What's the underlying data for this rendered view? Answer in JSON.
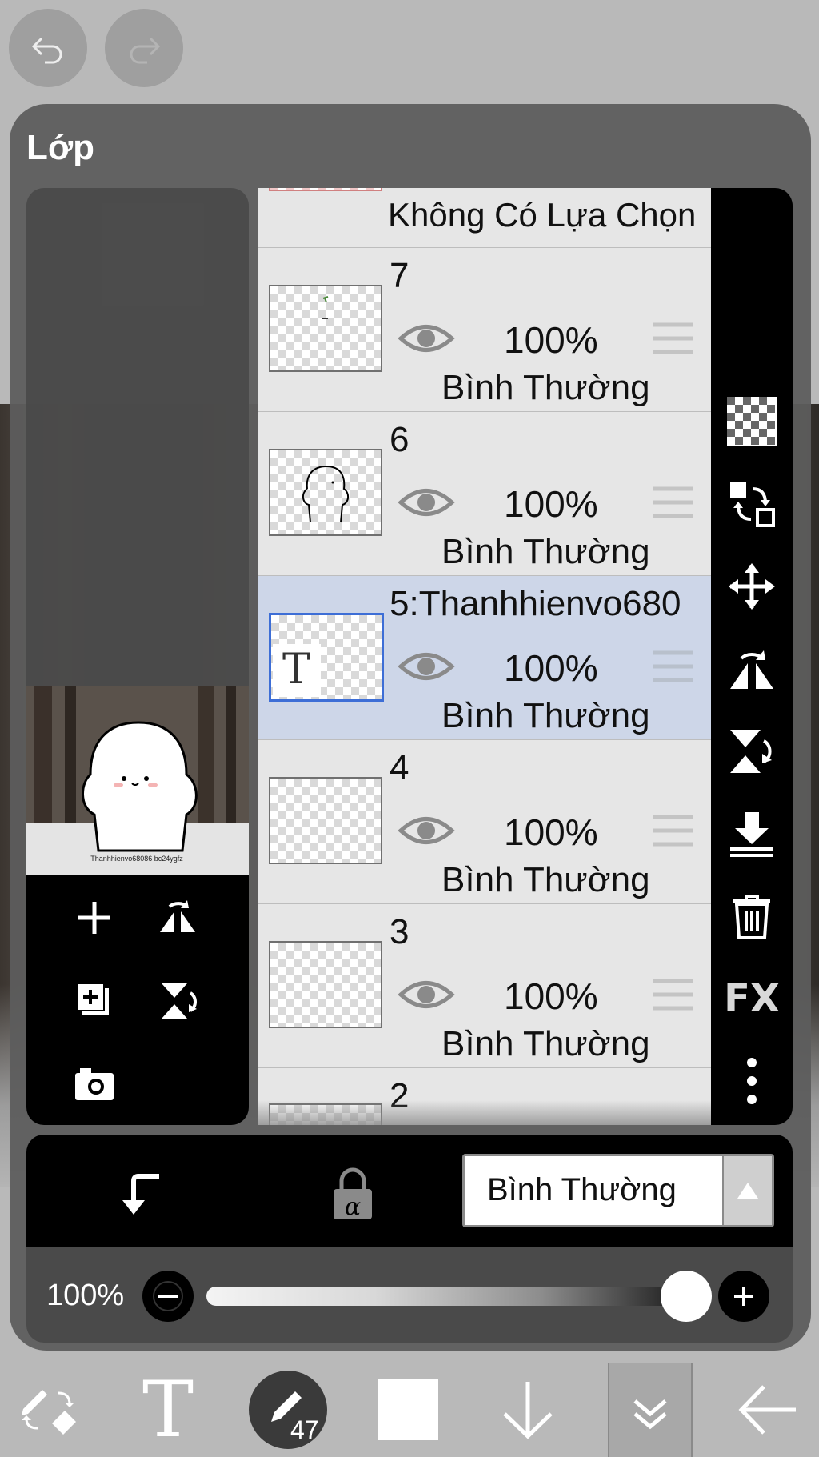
{
  "panel": {
    "title": "Lớp"
  },
  "preview": {
    "caption": "Thanhhienvo68086 bc24ygfz"
  },
  "layers": [
    {
      "name": "Không Có Lựa Chọn",
      "partial": true
    },
    {
      "name": "7",
      "opacity": "100%",
      "blend": "Bình Thường"
    },
    {
      "name": "6",
      "opacity": "100%",
      "blend": "Bình Thường"
    },
    {
      "name": "5:Thanhhienvo680",
      "opacity": "100%",
      "blend": "Bình Thường",
      "selected": true,
      "thumb_letter": "T"
    },
    {
      "name": "4",
      "opacity": "100%",
      "blend": "Bình Thường"
    },
    {
      "name": "3",
      "opacity": "100%",
      "blend": "Bình Thường"
    },
    {
      "name": "2"
    }
  ],
  "blend_mode": {
    "value": "Bình Thường"
  },
  "opacity": {
    "label": "100%",
    "value": 1.0
  },
  "right_tools": {
    "fx_label": "FX"
  },
  "bottom_toolbar": {
    "brush_size": "47"
  },
  "colors": {
    "selected_row": "#cdd6e8",
    "panel": "#5c5c5c",
    "accent_border": "#3d6ed6"
  }
}
